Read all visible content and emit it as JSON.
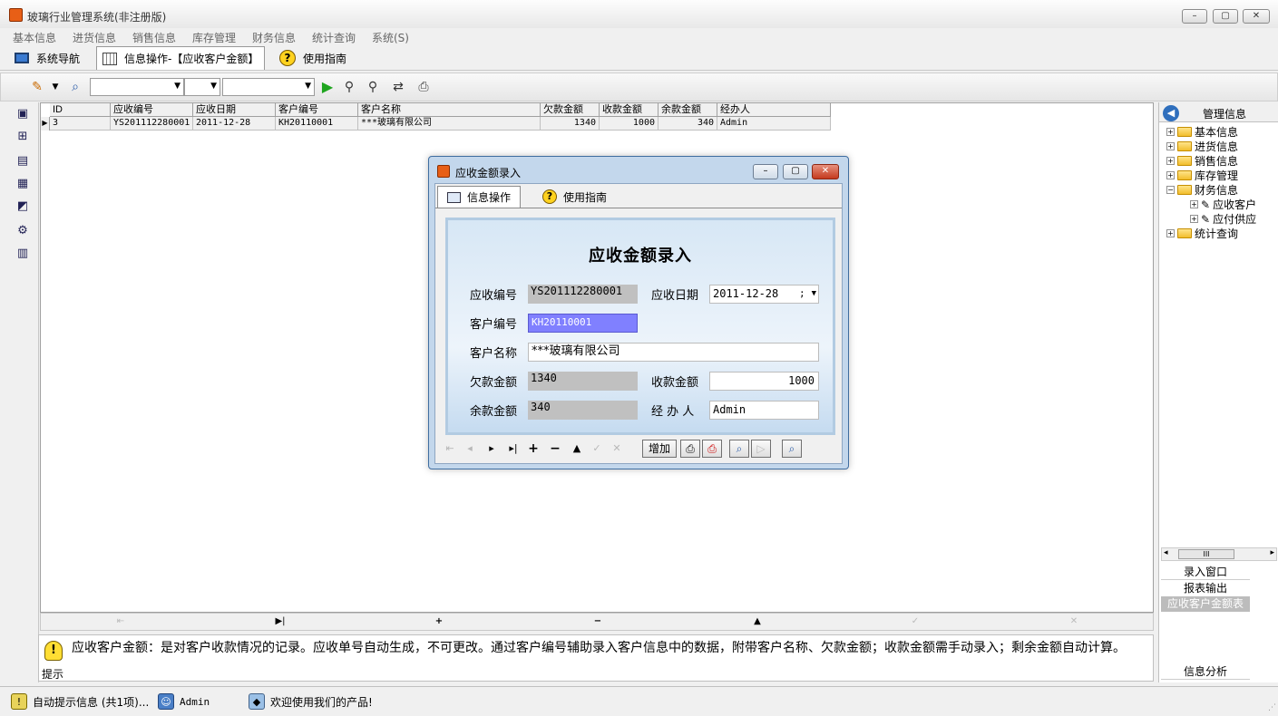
{
  "window": {
    "title": "玻璃行业管理系统(非注册版)",
    "min": "–",
    "max": "▢",
    "close": "✕"
  },
  "menu": [
    "基本信息",
    "进货信息",
    "销售信息",
    "库存管理",
    "财务信息",
    "统计查询",
    "系统(S)"
  ],
  "navtabs": {
    "nav": "系统导航",
    "info": "信息操作-【应收客户金额】",
    "guide": "使用指南"
  },
  "grid": {
    "headers": [
      "ID",
      "应收编号",
      "应收日期",
      "客户编号",
      "客户名称",
      "欠款金额",
      "收款金额",
      "余款金额",
      "经办人"
    ],
    "row": {
      "id": "3",
      "code": "YS201112280001",
      "date": "2011-12-28",
      "customer_code": "KH20110001",
      "customer_name": "***玻璃有限公司",
      "debt": "1340",
      "received": "1000",
      "balance": "340",
      "handler": "Admin"
    }
  },
  "hint": {
    "text": "应收客户金额：是对客户收款情况的记录。应收单号自动生成，不可更改。通过客户编号辅助录入客户信息中的数据，附带客户名称、欠款金额；收款金额需手动录入；剩余金额自动计算。",
    "label": "提示"
  },
  "status": {
    "auto_hint": "自动提示信息 (共1项)...",
    "user": "Admin",
    "welcome": "欢迎使用我们的产品!"
  },
  "right_panel": {
    "title": "管理信息",
    "tree": [
      "基本信息",
      "进货信息",
      "销售信息",
      "库存管理",
      "财务信息",
      "应收客户",
      "应付供应",
      "统计查询"
    ],
    "buttons": {
      "entry": "录入窗口",
      "report": "报表输出",
      "current": "应收客户金额表",
      "analysis": "信息分析"
    },
    "scroll_mark": "III"
  },
  "dialog": {
    "title": "应收金额录入",
    "tabs": {
      "info": "信息操作",
      "guide": "使用指南"
    },
    "form_title": "应收金额录入",
    "labels": {
      "code": "应收编号",
      "date": "应收日期",
      "customer_code": "客户编号",
      "customer_name": "客户名称",
      "debt": "欠款金额",
      "received": "收款金额",
      "balance": "余款金额",
      "handler": "经 办 人"
    },
    "values": {
      "code": "YS201112280001",
      "date": "2011-12-28",
      "date_suffix": ";",
      "customer_code": "KH20110001",
      "customer_name": "***玻璃有限公司",
      "debt": "1340",
      "received": "1000",
      "balance": "340",
      "handler": "Admin"
    },
    "add_label": "增加"
  }
}
